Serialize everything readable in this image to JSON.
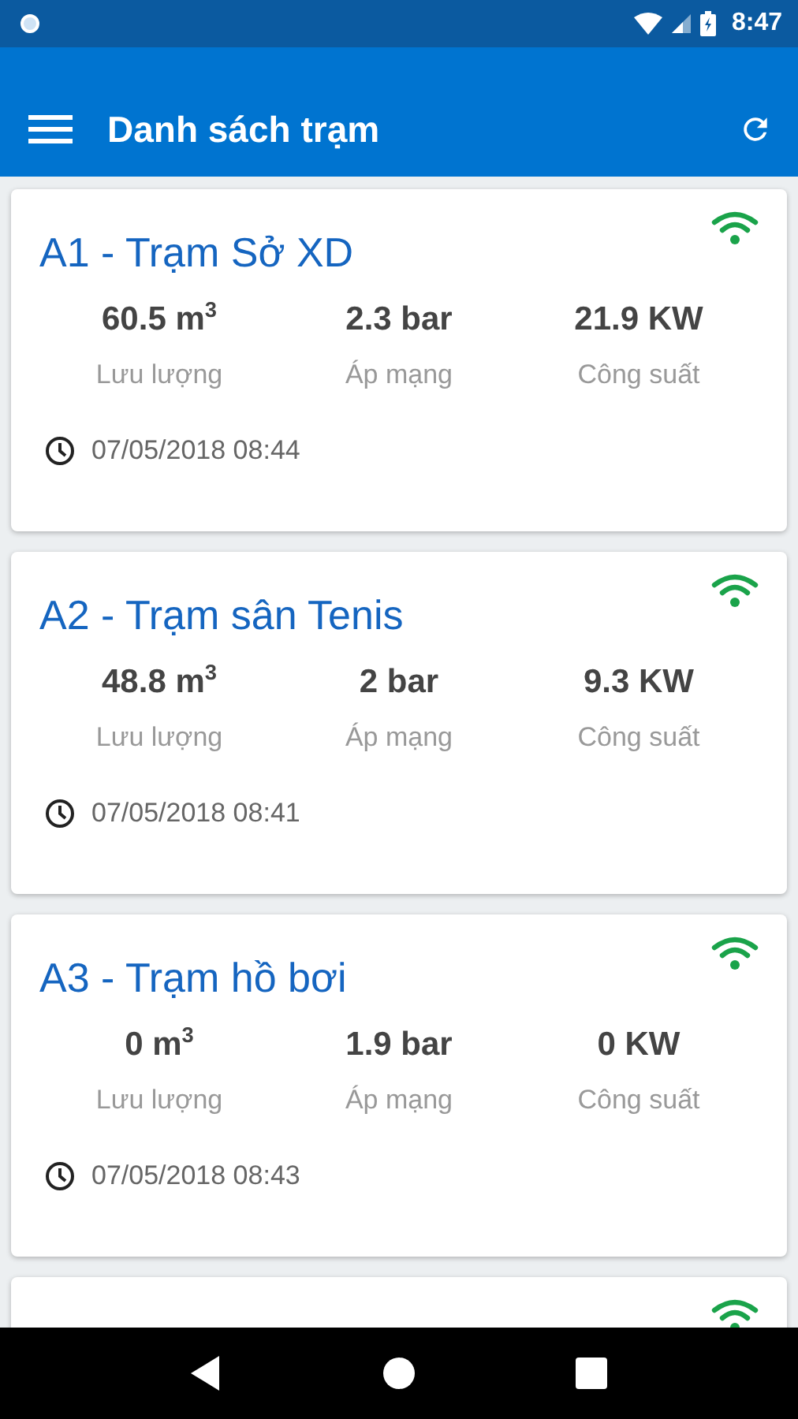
{
  "status_bar": {
    "time": "8:47"
  },
  "app_bar": {
    "title": "Danh sách trạm"
  },
  "stations": [
    {
      "name": "A1 - Trạm Sở XD",
      "online": true,
      "stats": [
        {
          "value": "60.5 m$^{3}$",
          "label": "Lưu lượng"
        },
        {
          "value": "2.3 bar",
          "label": "Áp mạng"
        },
        {
          "value": "21.9 KW",
          "label": "Công suất"
        }
      ],
      "time": "07/05/2018 08:44"
    },
    {
      "name": "A2 - Trạm sân Tenis",
      "online": true,
      "stats": [
        {
          "value": "48.8 m$^{3}$",
          "label": "Lưu lượng"
        },
        {
          "value": "2 bar",
          "label": "Áp mạng"
        },
        {
          "value": "9.3 KW",
          "label": "Công suất"
        }
      ],
      "time": "07/05/2018 08:41"
    },
    {
      "name": "A3 - Trạm hồ bơi",
      "online": true,
      "stats": [
        {
          "value": "0 m$^{3}$",
          "label": "Lưu lượng"
        },
        {
          "value": "1.9 bar",
          "label": "Áp mạng"
        },
        {
          "value": "0 KW",
          "label": "Công suất"
        }
      ],
      "time": "07/05/2018 08:43"
    },
    {
      "online": true
    }
  ]
}
